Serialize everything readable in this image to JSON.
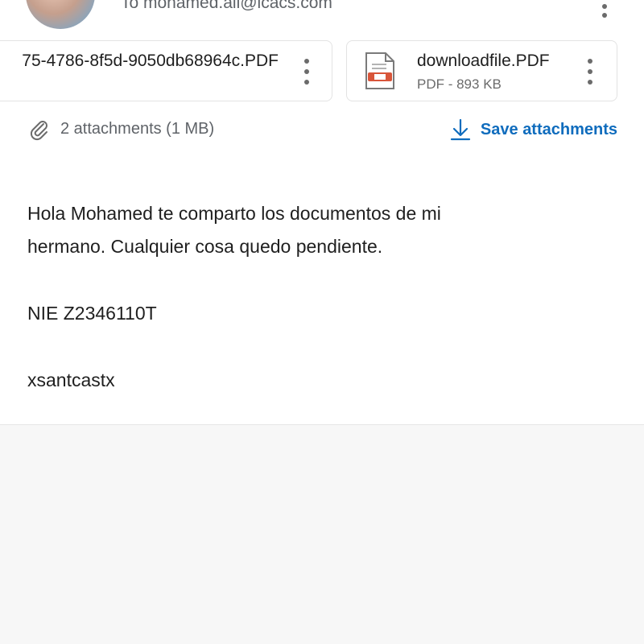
{
  "header": {
    "recipient": "To mohamed.ali@icacs.com",
    "more_icon": "more-vertical-icon"
  },
  "attachments": [
    {
      "name": "75-4786-8f5d-9050db68964c.PDF",
      "icon": "more-vertical-icon"
    },
    {
      "name": "downloadfile.PDF",
      "meta": "PDF - 893 KB",
      "icon": "pdf-file-icon"
    }
  ],
  "attachment_bar": {
    "summary": "2 attachments (1 MB)",
    "save_label": "Save attachments",
    "accent_color": "#0f6cbd"
  },
  "message": {
    "line1": "Hola Mohamed te comparto los documentos de mi",
    "line2": "hermano. Cualquier cosa quedo pendiente.",
    "line3": "NIE Z2346110T",
    "line4": "xsantcastx"
  }
}
